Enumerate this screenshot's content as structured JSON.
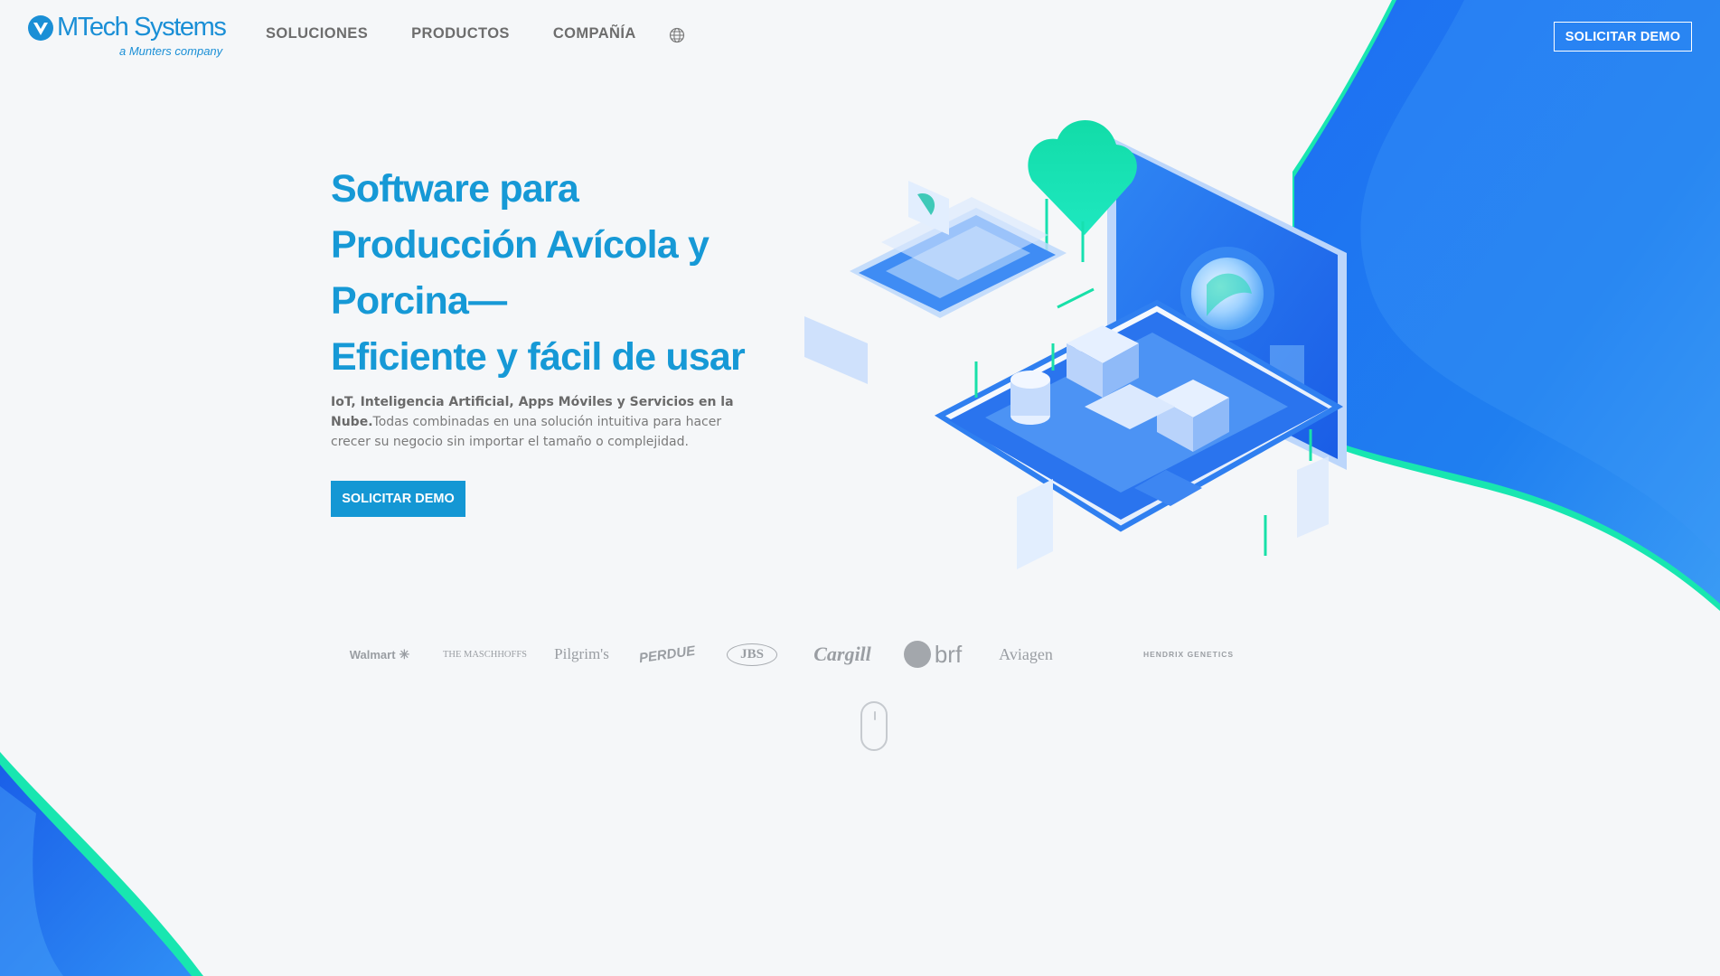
{
  "brand": {
    "name": "MTech Systems",
    "tagline": "a Munters company",
    "primary_color": "#1699d6",
    "accent_blue": "#1a6ff0",
    "accent_green": "#18e6b0"
  },
  "nav": {
    "items": [
      {
        "label": "SOLUCIONES"
      },
      {
        "label": "PRODUCTOS"
      },
      {
        "label": "COMPAÑÍA"
      }
    ],
    "language_icon": "globe-icon",
    "cta_label": "SOLICITAR DEMO"
  },
  "hero": {
    "title_lines": [
      "Software para",
      "Producción Avícola y",
      "Porcina—",
      "Eficiente y fácil de usar"
    ],
    "desc_bold": "IoT, Inteligencia Artificial, Apps Móviles y Servicios en la Nube.",
    "desc_text": "Todas combinadas en una solución intuitiva para hacer crecer su negocio sin importar el tamaño o complejidad.",
    "cta_label": "SOLICITAR DEMO"
  },
  "clients": {
    "logos": [
      {
        "name": "Walmart"
      },
      {
        "name": "THE MASCHHOFFS"
      },
      {
        "name": "Pilgrim's"
      },
      {
        "name": "PERDUE"
      },
      {
        "name": "JBS"
      },
      {
        "name": "Cargill"
      },
      {
        "name": "brf"
      },
      {
        "name": "Aviagen"
      },
      {
        "name": "HENDRIX GENETICS"
      }
    ]
  },
  "scroll_indicator_icon": "mouse-scroll-icon"
}
